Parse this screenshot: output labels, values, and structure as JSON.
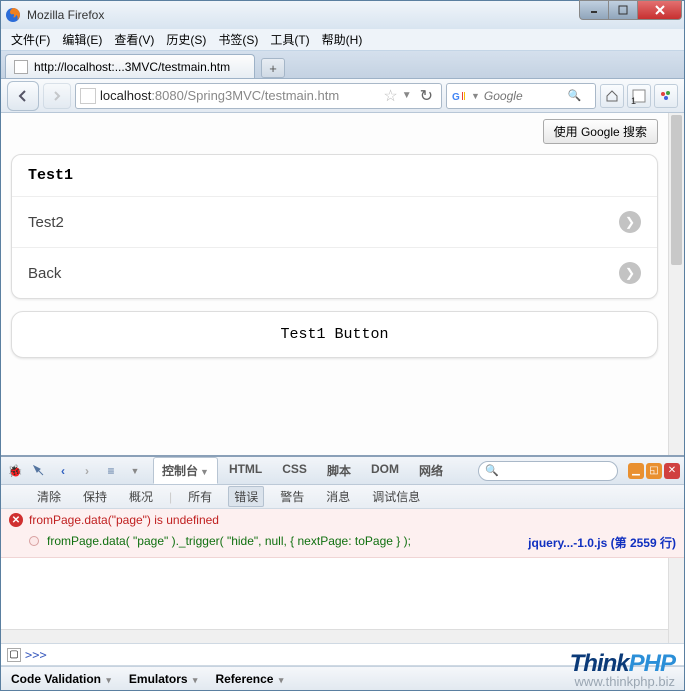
{
  "window": {
    "title": "Mozilla Firefox"
  },
  "menubar": [
    "文件(F)",
    "编辑(E)",
    "查看(V)",
    "历史(S)",
    "书签(S)",
    "工具(T)",
    "帮助(H)"
  ],
  "tab": {
    "label": "http://localhost:...3MVC/testmain.htm"
  },
  "urlbar": {
    "prefix": "localhost",
    "rest": ":8080/Spring3MVC/testmain.htm"
  },
  "searchbar": {
    "placeholder": "Google"
  },
  "toolbar_badge": "1",
  "page": {
    "google_btn": "使用 Google 搜索",
    "header": "Test1",
    "items": [
      "Test2",
      "Back"
    ],
    "button": "Test1 Button"
  },
  "firebug": {
    "tabs": [
      "控制台",
      "HTML",
      "CSS",
      "脚本",
      "DOM",
      "网络"
    ],
    "active_tab": 0,
    "subtabs": [
      "清除",
      "保持",
      "概况",
      "所有",
      "错误",
      "警告",
      "消息",
      "调试信息"
    ],
    "active_subtab": 4,
    "error_msg": "fromPage.data(\"page\") is undefined",
    "error_code": "fromPage.data( \"page\" )._trigger( \"hide\", null, { nextPage: toPage } );",
    "error_source": "jquery...-1.0.js (第 2559 行)",
    "prompt": ">>>"
  },
  "statusbar": [
    "Code Validation",
    "Emulators",
    "Reference"
  ],
  "watermark": {
    "brand1": "Think",
    "brand2": "PHP",
    "url": "www.thinkphp.biz"
  }
}
